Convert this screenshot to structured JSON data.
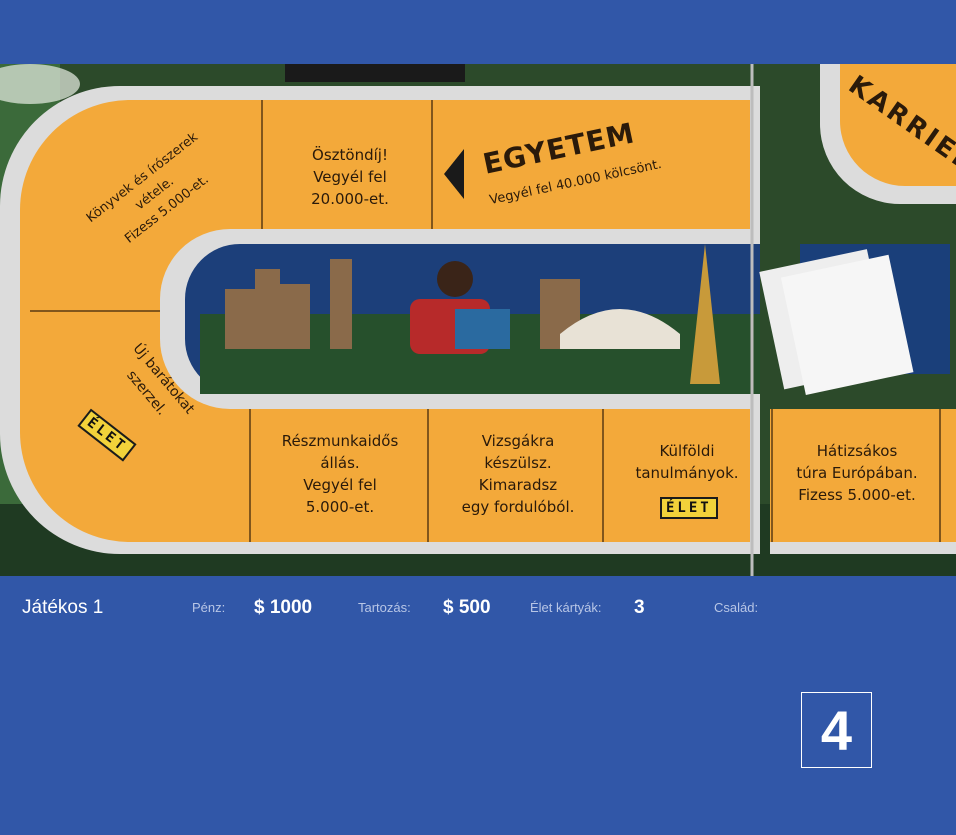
{
  "board": {
    "squares": {
      "books": "Könyvek és írószerek\nvétele.\nFizess 5.000-et.",
      "scholarship": "Ösztöndíj!\nVegyél fel\n20.000-et.",
      "university_title": "EGYETEM",
      "university_sub": "Vegyél fel 40.000 kölcsönt.",
      "career_title": "KARRIER",
      "friends": "Új barátokat\nszerzel.",
      "part_time": "Részmunkaidős\nállás.\nVegyél fel\n5.000-et.",
      "exams": "Vizsgákra\nkészülsz.\nKimaradsz\negy fordulóból.",
      "abroad": "Külföldi\ntanulmányok.",
      "backpack": "Hátizsákos\ntúra Európában.\nFizess 5.000-et.",
      "elet_badge": "ÉLET"
    },
    "colors": {
      "track": "#f2a93b",
      "track_border": "#d9d9d9",
      "sky": "#1a4a8a"
    }
  },
  "status": {
    "player": "Játékos 1",
    "money_label": "Pénz:",
    "money_value": "$ 1000",
    "debt_label": "Tartozás:",
    "debt_value": "$ 500",
    "life_cards_label": "Élet kártyák:",
    "life_cards_value": "3",
    "family_label": "Család:"
  },
  "dice": {
    "value": "4"
  }
}
